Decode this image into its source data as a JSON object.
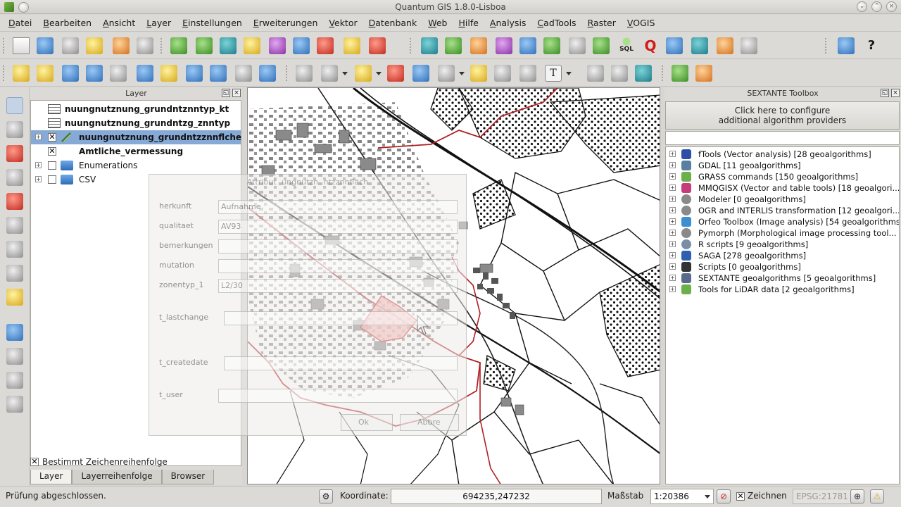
{
  "window": {
    "title": "Quantum GIS 1.8.0-Lisboa"
  },
  "menu": [
    "Datei",
    "Bearbeiten",
    "Ansicht",
    "Layer",
    "Einstellungen",
    "Erweiterungen",
    "Vektor",
    "Datenbank",
    "Web",
    "Hilfe",
    "Analysis",
    "CadTools",
    "Raster",
    "VOGIS"
  ],
  "layer_panel": {
    "title": "Layer",
    "layers": [
      {
        "name": "nuungnutznung_grundntznntyp_kt",
        "type": "table",
        "checked": false,
        "selected": false
      },
      {
        "name": "nuungnutznung_grundntzg_znntyp",
        "type": "table",
        "checked": false,
        "selected": false
      },
      {
        "name": "nuungnutznung_grundntzznnflche",
        "type": "vector-line",
        "checked": true,
        "selected": true
      },
      {
        "name": "Amtliche_vermessung",
        "type": "group",
        "checked": true,
        "selected": false
      },
      {
        "name": "Enumerations",
        "type": "group-folder",
        "checked": false,
        "selected": false
      },
      {
        "name": "CSV",
        "type": "group-folder",
        "checked": false,
        "selected": false
      }
    ],
    "order_checkbox_label": "Bestimmt Zeichenreihenfolge",
    "tabs": [
      {
        "label": "Layer",
        "active": true
      },
      {
        "label": "Layerreihenfolge",
        "active": false
      },
      {
        "label": "Browser",
        "active": false
      }
    ]
  },
  "attribute_dialog": {
    "title_fragments": [
      "Attribut",
      "ungnutzn",
      "ntzznnfläch"
    ],
    "fields": [
      {
        "label": "herkunft",
        "value": "Aufnahme"
      },
      {
        "label": "qualitaet",
        "value": "AV93"
      },
      {
        "label": "bemerkungen",
        "value": ""
      },
      {
        "label": "mutation",
        "value": ""
      },
      {
        "label": "zonentyp_1",
        "value": "L2/30"
      },
      {
        "label": "t_lastchange",
        "value": ""
      },
      {
        "label": "t_createdate",
        "value": ""
      },
      {
        "label": "t_user",
        "value": ""
      }
    ],
    "ok_label": "Ok",
    "cancel_label": "Abbre"
  },
  "sextante": {
    "title": "SEXTANTE Toolbox",
    "config_line1": "Click here to configure",
    "config_line2": "additional algorithm providers",
    "providers": [
      {
        "label": "fTools (Vector analysis) [28 geoalgorithms]",
        "icon": "ftools-icon",
        "color": "#2d4fa8"
      },
      {
        "label": "GDAL [11 geoalgorithms]",
        "icon": "gdal-icon",
        "color": "#5a7fa0"
      },
      {
        "label": "GRASS commands [150 geoalgorithms]",
        "icon": "grass-icon",
        "color": "#6bb04a"
      },
      {
        "label": "MMQGISX (Vector and table tools) [18 geoalgori...",
        "icon": "mmqgis-icon",
        "color": "#c43c7a"
      },
      {
        "label": "Modeler [0 geoalgorithms]",
        "icon": "gear-icon",
        "color": "#8a8a8a"
      },
      {
        "label": "OGR and INTERLIS transformation [12 geoalgori...",
        "icon": "gear-icon",
        "color": "#8a8a8a"
      },
      {
        "label": "Orfeo Toolbox (Image analysis) [54 geoalgorithms]",
        "icon": "orfeo-icon",
        "color": "#3c8fd0"
      },
      {
        "label": "Pymorph (Morphological image processing tool...",
        "icon": "gear-icon",
        "color": "#8a8a8a"
      },
      {
        "label": "R scripts [9 geoalgorithms]",
        "icon": "r-icon",
        "color": "#7a8ea8"
      },
      {
        "label": "SAGA [278 geoalgorithms]",
        "icon": "saga-icon",
        "color": "#2f5fb0"
      },
      {
        "label": "Scripts [0 geoalgorithms]",
        "icon": "script-icon",
        "color": "#333333"
      },
      {
        "label": "SEXTANTE geoalgorithms [5 geoalgorithms]",
        "icon": "sextante-icon",
        "color": "#5a6a8a"
      },
      {
        "label": "Tools for LiDAR data [2 geoalgorithms]",
        "icon": "lidar-icon",
        "color": "#6bb04a"
      }
    ]
  },
  "status": {
    "message": "Prüfung abgeschlossen.",
    "coord_label": "Koordinate:",
    "coord_value": "694235,247232",
    "scale_label": "Maßstab",
    "scale_value": "1:20386",
    "render_label": "Zeichnen",
    "epsg": "EPSG:21781"
  },
  "colors": {
    "selection": "#86a9d6",
    "zone_boundary": "#b01f24",
    "selected_feature": "#f2a7a7"
  }
}
